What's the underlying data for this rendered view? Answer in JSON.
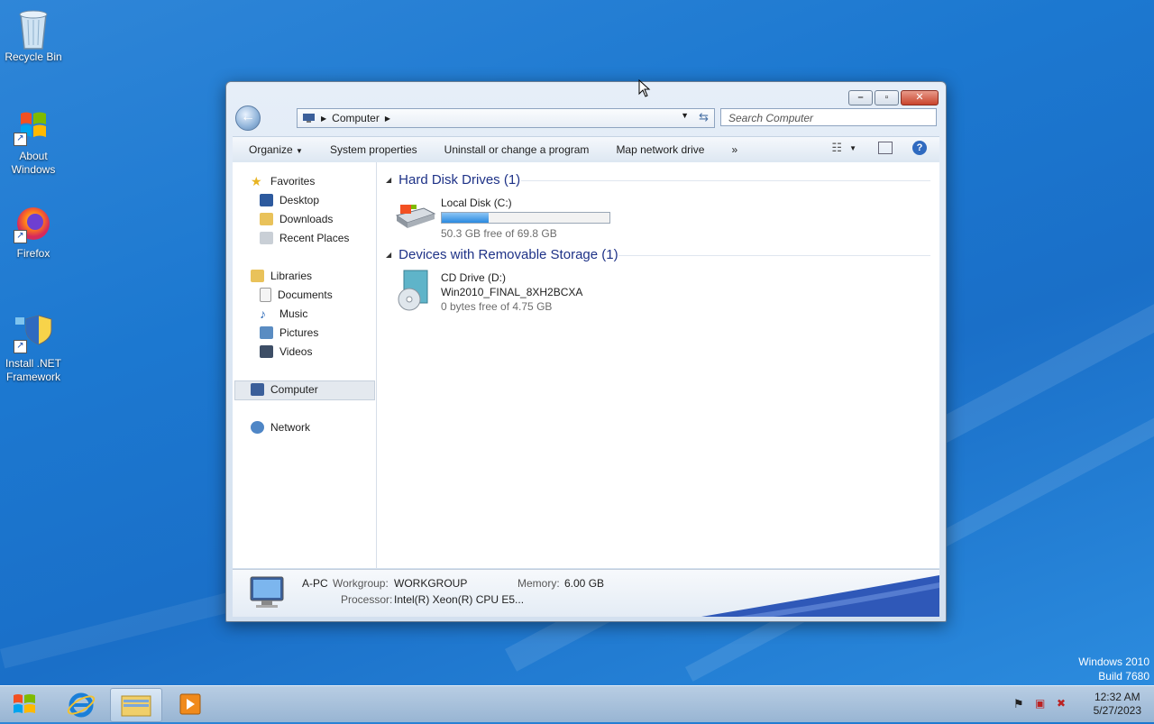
{
  "desktop": {
    "icons": [
      {
        "label": "Recycle Bin",
        "icon": "recycle-bin-icon"
      },
      {
        "label": "About Windows",
        "icon": "windows-flag-icon"
      },
      {
        "label": "Firefox",
        "icon": "firefox-icon"
      },
      {
        "label": "Install .NET Framework",
        "icon": "dotnet-shield-icon"
      }
    ],
    "watermark": {
      "line1": "Windows 2010",
      "line2": "Build 7680"
    }
  },
  "window": {
    "address": {
      "location": "Computer"
    },
    "search": {
      "placeholder": "Search Computer"
    },
    "toolbar": {
      "organize": "Organize",
      "system_properties": "System properties",
      "uninstall": "Uninstall or change a program",
      "map_drive": "Map network drive",
      "more": "»"
    },
    "nav": {
      "favorites": "Favorites",
      "desktop": "Desktop",
      "downloads": "Downloads",
      "recent": "Recent Places",
      "libraries": "Libraries",
      "documents": "Documents",
      "music": "Music",
      "pictures": "Pictures",
      "videos": "Videos",
      "computer": "Computer",
      "network": "Network"
    },
    "groups": {
      "hdd": {
        "title": "Hard Disk Drives (1)"
      },
      "removable": {
        "title": "Devices with Removable Storage (1)"
      }
    },
    "drives": {
      "c": {
        "name": "Local Disk (C:)",
        "free": "50.3 GB free of 69.8 GB",
        "used_fraction": 0.28
      },
      "d": {
        "name": "CD Drive (D:)",
        "label": "Win2010_FINAL_8XH2BCXA",
        "free": "0 bytes free of 4.75 GB"
      }
    },
    "details": {
      "name": "A-PC",
      "workgroup_label": "Workgroup:",
      "workgroup": "WORKGROUP",
      "memory_label": "Memory:",
      "memory": "6.00 GB",
      "processor_label": "Processor:",
      "processor": "Intel(R) Xeon(R) CPU E5..."
    }
  },
  "taskbar": {
    "clock": {
      "time": "12:32 AM",
      "date": "5/27/2023"
    },
    "apps": [
      "internet-explorer-icon",
      "explorer-folder-icon",
      "media-player-icon"
    ]
  },
  "colors": {
    "accent": "#1e3287",
    "desktop": "#1c78d0",
    "progress": "#2b8ae0"
  }
}
